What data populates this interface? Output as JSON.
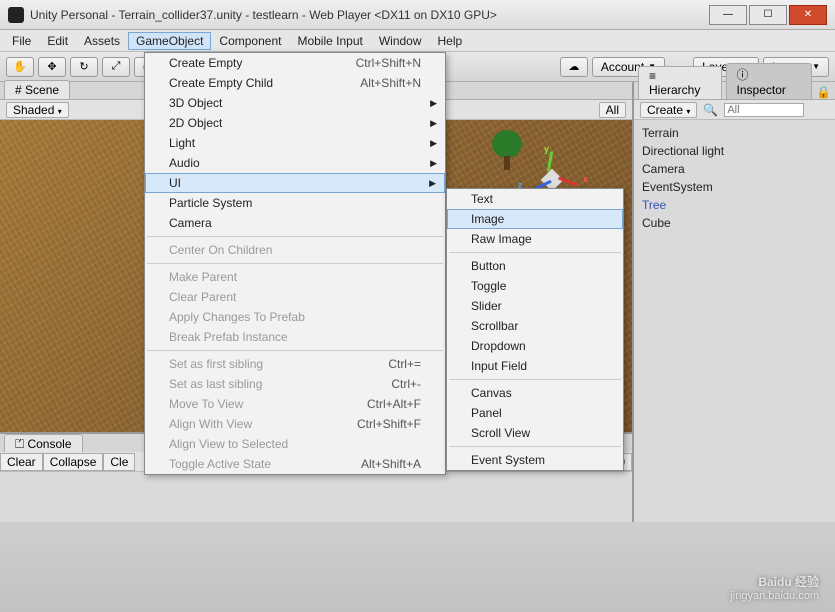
{
  "window": {
    "title": "Unity Personal - Terrain_collider37.unity - testlearn - Web Player <DX11 on DX10 GPU>"
  },
  "menubar": [
    "File",
    "Edit",
    "Assets",
    "GameObject",
    "Component",
    "Mobile Input",
    "Window",
    "Help"
  ],
  "toolbar": {
    "account": "Account",
    "layers": "Layers",
    "layout": "Layout"
  },
  "scene": {
    "tab": "Scene",
    "shaded": "Shaded",
    "all": "All"
  },
  "console": {
    "tab": "Console",
    "clear": "Clear",
    "collapse": "Collapse",
    "clear_on_play": "Cle"
  },
  "hierarchy": {
    "tab": "Hierarchy",
    "inspector_tab": "Inspector",
    "create": "Create",
    "search_placeholder": "All",
    "items": [
      "Terrain",
      "Directional light",
      "Camera",
      "EventSystem",
      "Tree",
      "Cube"
    ]
  },
  "menu1": {
    "items": [
      {
        "label": "Create Empty",
        "shortcut": "Ctrl+Shift+N"
      },
      {
        "label": "Create Empty Child",
        "shortcut": "Alt+Shift+N"
      },
      {
        "label": "3D Object",
        "sub": true
      },
      {
        "label": "2D Object",
        "sub": true
      },
      {
        "label": "Light",
        "sub": true
      },
      {
        "label": "Audio",
        "sub": true
      },
      {
        "label": "UI",
        "sub": true,
        "selected": true
      },
      {
        "label": "Particle System"
      },
      {
        "label": "Camera"
      },
      {
        "sep": true
      },
      {
        "label": "Center On Children",
        "disabled": true
      },
      {
        "sep": true
      },
      {
        "label": "Make Parent",
        "disabled": true
      },
      {
        "label": "Clear Parent",
        "disabled": true
      },
      {
        "label": "Apply Changes To Prefab",
        "disabled": true
      },
      {
        "label": "Break Prefab Instance",
        "disabled": true
      },
      {
        "sep": true
      },
      {
        "label": "Set as first sibling",
        "shortcut": "Ctrl+=",
        "disabled": true
      },
      {
        "label": "Set as last sibling",
        "shortcut": "Ctrl+-",
        "disabled": true
      },
      {
        "label": "Move To View",
        "shortcut": "Ctrl+Alt+F",
        "disabled": true
      },
      {
        "label": "Align With View",
        "shortcut": "Ctrl+Shift+F",
        "disabled": true
      },
      {
        "label": "Align View to Selected",
        "disabled": true
      },
      {
        "label": "Toggle Active State",
        "shortcut": "Alt+Shift+A",
        "disabled": true
      }
    ]
  },
  "menu2": {
    "items": [
      {
        "label": "Text"
      },
      {
        "label": "Image",
        "highlight": true
      },
      {
        "label": "Raw Image"
      },
      {
        "sep": true
      },
      {
        "label": "Button"
      },
      {
        "label": "Toggle"
      },
      {
        "label": "Slider"
      },
      {
        "label": "Scrollbar"
      },
      {
        "label": "Dropdown"
      },
      {
        "label": "Input Field"
      },
      {
        "sep": true
      },
      {
        "label": "Canvas"
      },
      {
        "label": "Panel"
      },
      {
        "label": "Scroll View"
      },
      {
        "sep": true
      },
      {
        "label": "Event System"
      }
    ]
  },
  "watermark": {
    "brand": "Baidu 经验",
    "url": "jingyan.baidu.com"
  },
  "badge_count": "0"
}
